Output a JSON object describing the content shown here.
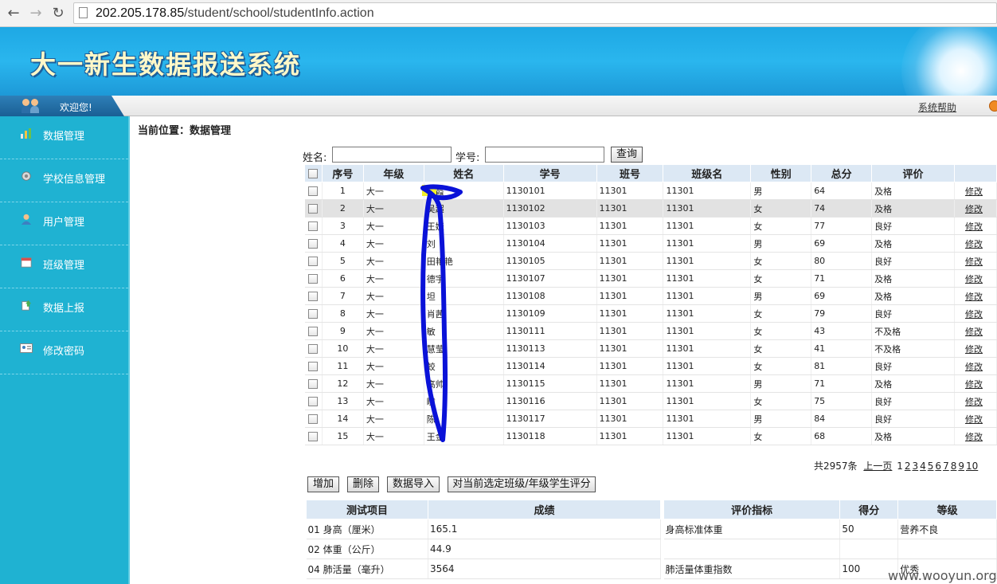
{
  "browser": {
    "url_host": "202.205.178.85",
    "url_path": "/student/school/studentInfo.action"
  },
  "banner": {
    "title": "大一新生数据报送系统"
  },
  "topbar": {
    "welcome": "欢迎您!",
    "help": "系统帮助"
  },
  "sidebar": {
    "items": [
      {
        "label": "数据管理",
        "icon": "bar-chart-icon"
      },
      {
        "label": "学校信息管理",
        "icon": "gear-icon"
      },
      {
        "label": "用户管理",
        "icon": "user-icon"
      },
      {
        "label": "班级管理",
        "icon": "calendar-icon"
      },
      {
        "label": "数据上报",
        "icon": "upload-icon"
      },
      {
        "label": "修改密码",
        "icon": "id-card-icon"
      }
    ]
  },
  "main": {
    "breadcrumb": "当前位置：数据管理",
    "search": {
      "name_label": "姓名:",
      "id_label": "学号:",
      "query_button": "查询"
    },
    "table": {
      "headers": [
        "序号",
        "年级",
        "姓名",
        "学号",
        "班号",
        "班级名",
        "性别",
        "总分",
        "评价"
      ],
      "edit_label": "修改",
      "rows": [
        [
          "1",
          "大一",
          "吴霞",
          "1130101",
          "11301",
          "11301",
          "男",
          "64",
          "及格"
        ],
        [
          "2",
          "大一",
          "吴超",
          "1130102",
          "11301",
          "11301",
          "女",
          "74",
          "及格"
        ],
        [
          "3",
          "大一",
          "王婕",
          "1130103",
          "11301",
          "11301",
          "女",
          "77",
          "良好"
        ],
        [
          "4",
          "大一",
          "刘",
          "1130104",
          "11301",
          "11301",
          "男",
          "69",
          "及格"
        ],
        [
          "5",
          "大一",
          "田艳艳",
          "1130105",
          "11301",
          "11301",
          "女",
          "80",
          "良好"
        ],
        [
          "6",
          "大一",
          "德宇",
          "1130107",
          "11301",
          "11301",
          "女",
          "71",
          "及格"
        ],
        [
          "7",
          "大一",
          "坦",
          "1130108",
          "11301",
          "11301",
          "男",
          "69",
          "及格"
        ],
        [
          "8",
          "大一",
          "肖茜",
          "1130109",
          "11301",
          "11301",
          "女",
          "79",
          "良好"
        ],
        [
          "9",
          "大一",
          "敏",
          "1130111",
          "11301",
          "11301",
          "女",
          "43",
          "不及格"
        ],
        [
          "10",
          "大一",
          "慧莹",
          "1130113",
          "11301",
          "11301",
          "女",
          "41",
          "不及格"
        ],
        [
          "11",
          "大一",
          "蛟",
          "1130114",
          "11301",
          "11301",
          "女",
          "81",
          "良好"
        ],
        [
          "12",
          "大一",
          "高帅",
          "1130115",
          "11301",
          "11301",
          "男",
          "71",
          "及格"
        ],
        [
          "13",
          "大一",
          "瞳",
          "1130116",
          "11301",
          "11301",
          "女",
          "75",
          "良好"
        ],
        [
          "14",
          "大一",
          "陈",
          "1130117",
          "11301",
          "11301",
          "男",
          "84",
          "良好"
        ],
        [
          "15",
          "大一",
          "王金",
          "1130118",
          "11301",
          "11301",
          "女",
          "68",
          "及格"
        ]
      ]
    },
    "pagination": {
      "total": "共2957条",
      "prev": "上一页",
      "pages": [
        "1",
        "2",
        "3",
        "4",
        "5",
        "6",
        "7",
        "8",
        "9",
        "10"
      ]
    },
    "actions": {
      "add": "增加",
      "delete": "删除",
      "import": "数据导入",
      "score": "对当前选定班级/年级学生评分"
    },
    "tests": {
      "headers": [
        "测试项目",
        "成绩"
      ],
      "rows": [
        [
          "01 身高（厘米）",
          "165.1"
        ],
        [
          "02 体重（公斤）",
          "44.9"
        ],
        [
          "04 肺活量（毫升）",
          "3564"
        ]
      ]
    },
    "evals": {
      "headers": [
        "评价指标",
        "得分",
        "等级"
      ],
      "rows": [
        [
          "身高标准体重",
          "50",
          "营养不良"
        ],
        [
          "",
          "",
          ""
        ],
        [
          "肺活量体重指数",
          "100",
          "优秀"
        ]
      ]
    }
  },
  "watermark": "www.wooyun.org",
  "colors": {
    "sidebar": "#1fb2d2",
    "banner": "#1ea8e4",
    "header_row": "#dce8f4",
    "scribble": "#0a12d8"
  }
}
